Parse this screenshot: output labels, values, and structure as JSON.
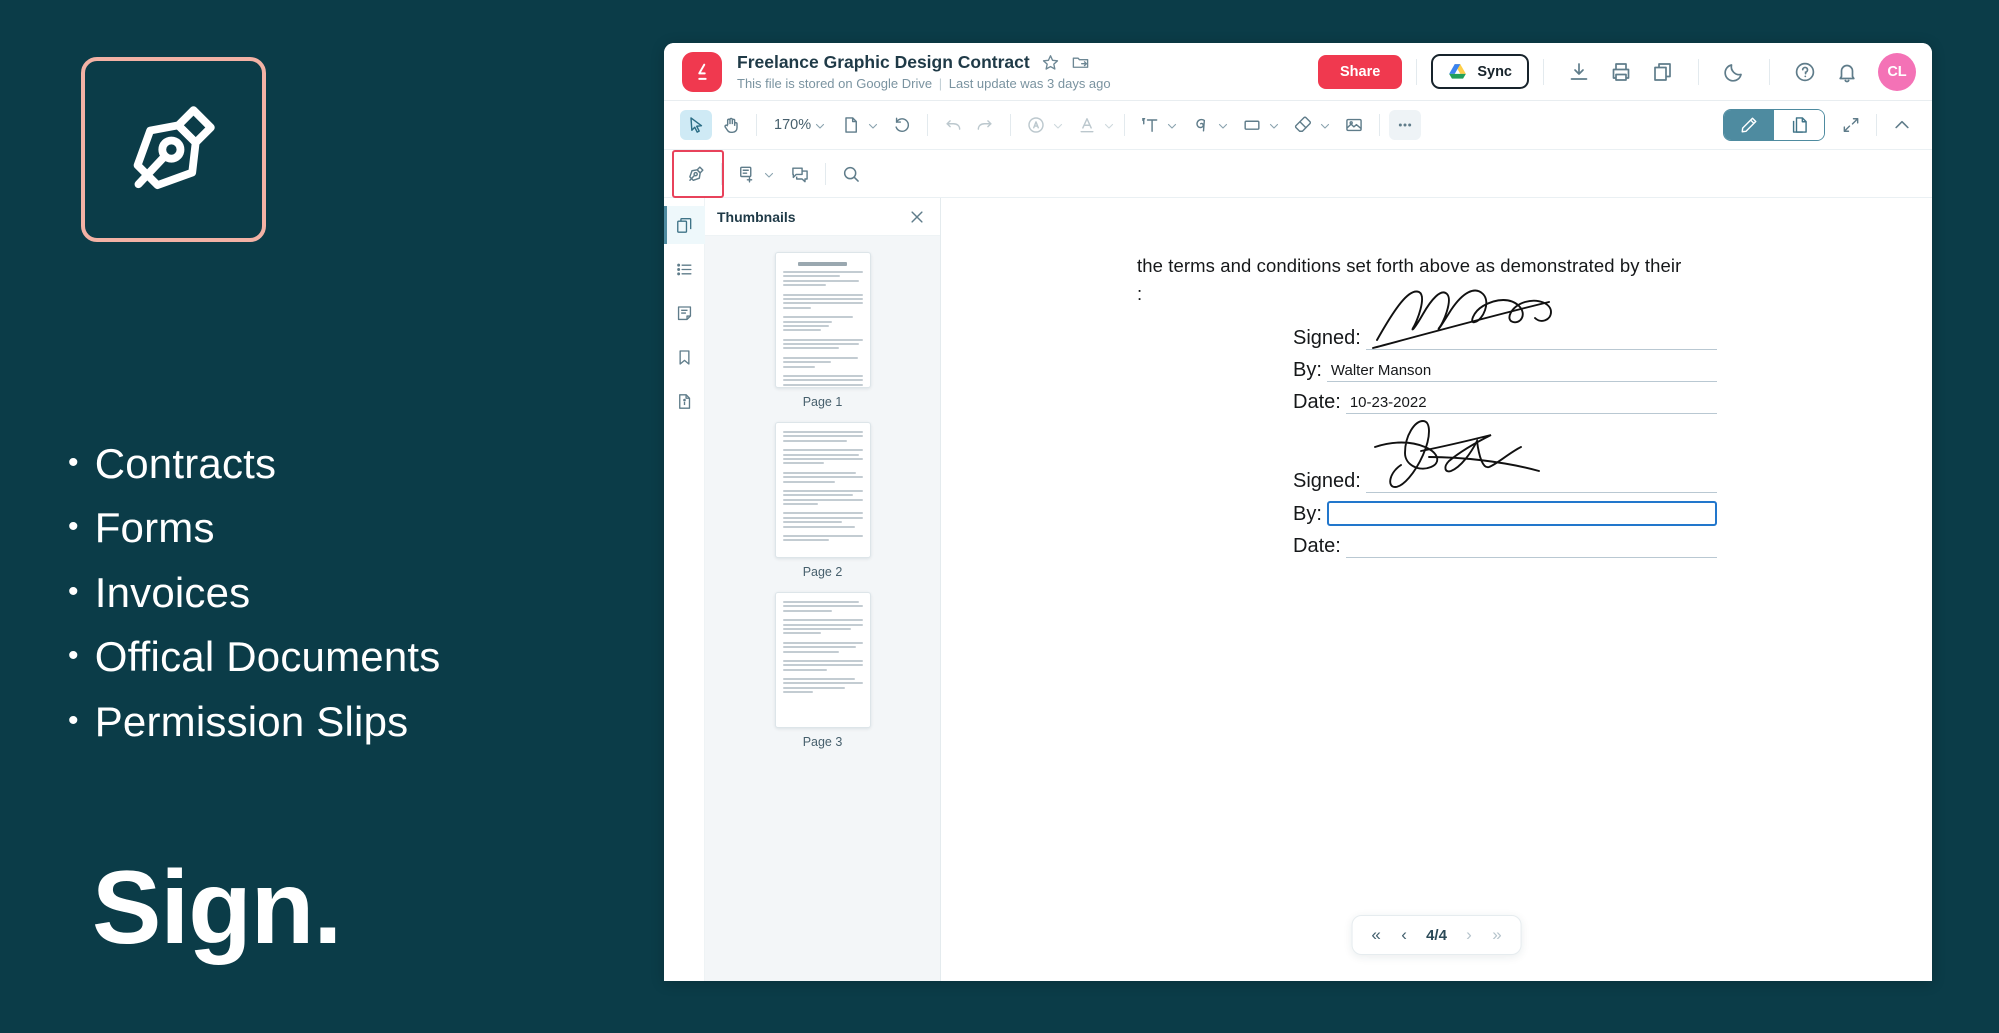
{
  "promo": {
    "logo_icon": "pen-nib-icon",
    "list": [
      "Contracts",
      "Forms",
      "Invoices",
      "Offical Documents",
      "Permission Slips"
    ],
    "bullet": "•",
    "headline": "Sign.",
    "background_color": "#0b3c48",
    "logo_border_color": "#f3b2a5"
  },
  "header": {
    "brand_icon": "lumin-logo-icon",
    "brand_color": "#f0394f",
    "title": "Freelance Graphic Design Contract",
    "star_icon": "star-icon",
    "move_icon": "move-to-folder-icon",
    "subtitle_storage": "This file is stored on Google Drive",
    "subtitle_sep": "|",
    "subtitle_update": "Last update was 3 days ago",
    "share_label": "Share",
    "sync_label": "Sync",
    "sync_icon": "google-drive-icon",
    "icons": [
      "download-icon",
      "print-icon",
      "copy-icon",
      "dark-mode-icon",
      "help-icon",
      "notifications-icon"
    ],
    "avatar_initials": "CL",
    "avatar_color": "#f472b6"
  },
  "toolbar": {
    "select_icon": "cursor-select-icon",
    "pan_icon": "hand-pan-icon",
    "zoom_level": "170%",
    "page_fit_icon": "page-fit-icon",
    "reset_icon": "reset-rotate-icon",
    "undo_icon": "undo-icon",
    "redo_icon": "redo-icon",
    "highlight_icon": "highlight-annotate-icon",
    "text_style_icon": "text-color-icon",
    "add_text_icon": "add-text-icon",
    "draw_icon": "freehand-draw-icon",
    "shape_icon": "shape-rectangle-icon",
    "eraser_icon": "eraser-icon",
    "image_icon": "insert-image-icon",
    "more_icon": "more-options-icon",
    "edit_mode_icon": "pencil-edit-icon",
    "page_mode_icon": "page-organize-icon",
    "fullscreen_icon": "expand-fullscreen-icon",
    "collapse_icon": "collapse-chevron-icon"
  },
  "subbar": {
    "sign_icon": "pen-sign-icon",
    "note_icon": "add-note-icon",
    "comment_icon": "comments-icon",
    "search_icon": "search-icon",
    "highlight_color": "#e8425b"
  },
  "rail": {
    "items": [
      {
        "icon": "thumbnails-icon",
        "active": true
      },
      {
        "icon": "outline-list-icon",
        "active": false
      },
      {
        "icon": "annotations-icon",
        "active": false
      },
      {
        "icon": "bookmarks-icon",
        "active": false
      },
      {
        "icon": "file-info-icon",
        "active": false
      }
    ]
  },
  "thumbnails": {
    "panel_title": "Thumbnails",
    "close_icon": "close-icon",
    "pages": [
      {
        "label": "Page 1",
        "doc_heading": "GRAPHIC DESIGN AGREEMENT"
      },
      {
        "label": "Page 2",
        "doc_heading": ""
      },
      {
        "label": "Page 3",
        "doc_heading": ""
      }
    ]
  },
  "document": {
    "paragraph": "the terms and conditions set forth above as demonstrated by their",
    "colon": ":",
    "signature_blocks": [
      {
        "signed_label": "Signed:",
        "signed_value": "",
        "by_label": "By:",
        "by_value": "Walter Manson",
        "date_label": "Date:",
        "date_value": "10-23-2022",
        "by_focused": false
      },
      {
        "signed_label": "Signed:",
        "signed_value": "",
        "by_label": "By:",
        "by_value": "",
        "date_label": "Date:",
        "date_value": "",
        "by_focused": true
      }
    ]
  },
  "pager": {
    "first_icon": "«",
    "prev_icon": "‹",
    "current": "4/4",
    "next_icon": "›",
    "last_icon": "»"
  }
}
